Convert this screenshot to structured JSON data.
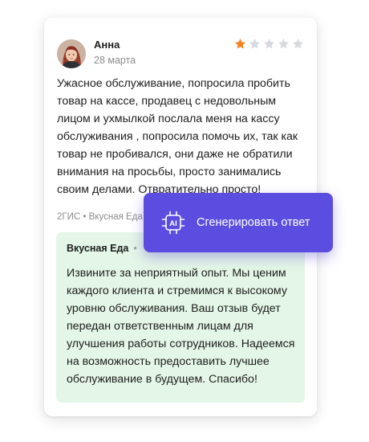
{
  "review": {
    "author": "Анна",
    "date": "28 марта",
    "rating": 1,
    "max_rating": 5,
    "text": "Ужасное обслуживание, попросила пробить товар на кассе, продавец с недовольным лицом и ухмылкой послала меня на кассу обслуживания , попросила помочь их, так как товар не пробивался, они даже не обратили внимания на просьбы, просто занимались своим делами. Отвратительно просто!",
    "source": "2ГИС",
    "separator": "•",
    "place": "Вкусная Еда"
  },
  "reply": {
    "author": "Вкусная Еда",
    "separator": "•",
    "text": "Извините за неприятный опыт. Мы ценим каждого клиента и стремимся к высокому уровню обслуживания. Ваш отзыв будет передан ответственным лицам для улучшения работы сотрудников. Надеемся на возможность предоставить лучшее обслуживание в будущем. Спасибо!"
  },
  "ai_button": {
    "label": "Сгенерировать ответ",
    "icon_text": "AI",
    "icon": "ai-chip-icon"
  },
  "colors": {
    "star_filled": "#f5821f",
    "star_empty": "#d6dadf",
    "reply_bg": "#e4f6e7",
    "accent": "#5b4de0"
  }
}
